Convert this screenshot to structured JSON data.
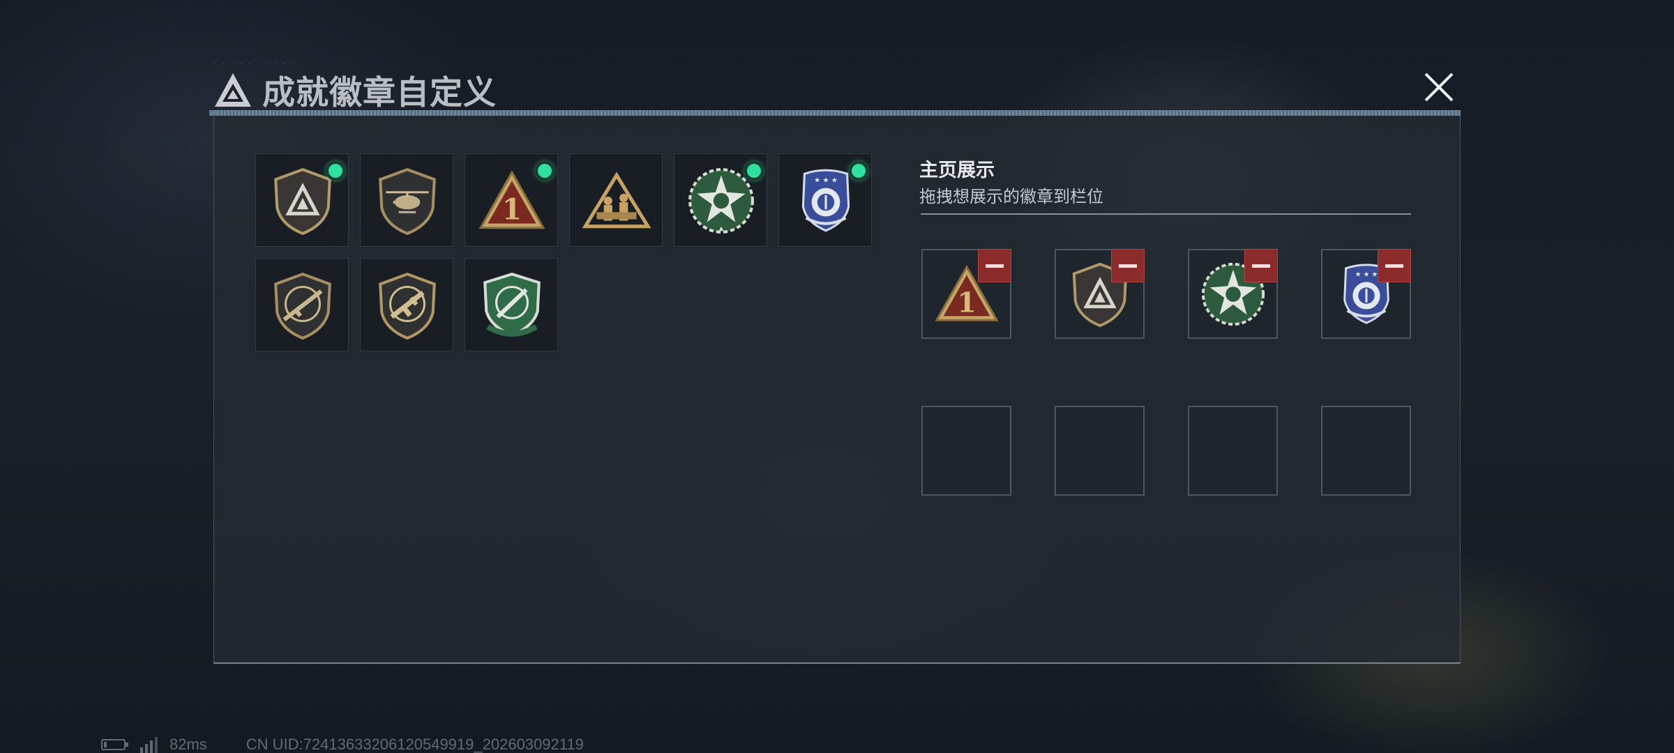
{
  "header": {
    "title": "成就徽章自定义",
    "logo_icon": "triangle-logo-icon",
    "close_icon": "close-icon"
  },
  "owned_badges": [
    {
      "icon": "triangle-shield-badge-icon",
      "equipped": true
    },
    {
      "icon": "helicopter-shield-badge-icon",
      "equipped": false
    },
    {
      "icon": "number-one-triangle-badge-icon",
      "equipped": true
    },
    {
      "icon": "soldiers-triangle-badge-icon",
      "equipped": false
    },
    {
      "icon": "green-star-medal-badge-icon",
      "equipped": true
    },
    {
      "icon": "blue-police-badge-icon",
      "equipped": true
    },
    {
      "icon": "rifle-shield-badge-icon",
      "equipped": false
    },
    {
      "icon": "smg-shield-badge-icon",
      "equipped": false
    },
    {
      "icon": "green-knife-crest-badge-icon",
      "equipped": false
    }
  ],
  "showcase": {
    "title": "主页展示",
    "subtitle": "拖拽想展示的徽章到栏位",
    "slots": [
      {
        "icon": "number-one-triangle-badge-icon"
      },
      {
        "icon": "triangle-shield-badge-icon"
      },
      {
        "icon": "green-star-medal-badge-icon"
      },
      {
        "icon": "blue-police-badge-icon"
      },
      {
        "icon": null
      },
      {
        "icon": null
      },
      {
        "icon": null
      },
      {
        "icon": null
      }
    ],
    "remove_icon": "minus-icon"
  },
  "status": {
    "latency": "82ms",
    "uid": "CN UID:7241363320612054991​9_202603092119"
  },
  "colors": {
    "equipped_dot": "#30e0a0",
    "remove_button": "#8c2b2b",
    "panel_border": "#4b535c"
  }
}
